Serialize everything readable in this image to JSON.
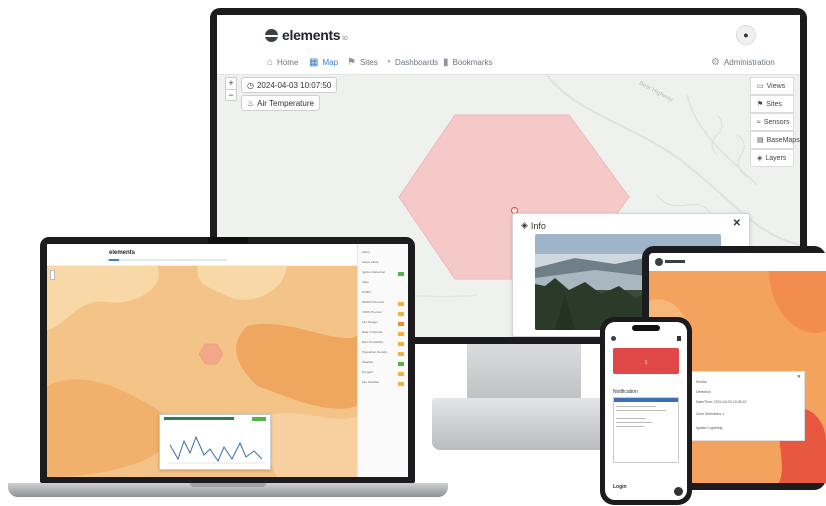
{
  "monitor": {
    "brand": {
      "name": "elements",
      "suffix": "io"
    },
    "user_icon": "user-icon",
    "nav": {
      "items": [
        {
          "label": "Home",
          "icon": "home-icon",
          "glyph": "⌂"
        },
        {
          "label": "Map",
          "icon": "map-icon",
          "glyph": "▦",
          "active": true
        },
        {
          "label": "Sites",
          "icon": "flag-icon",
          "glyph": "⚑"
        },
        {
          "label": "Dashboards",
          "icon": "dashboard-icon",
          "glyph": "◔"
        },
        {
          "label": "Bookmarks",
          "icon": "bookmark-icon",
          "glyph": "▮"
        }
      ],
      "admin": {
        "label": "Administration",
        "icon": "gear-icon",
        "glyph": "⚙"
      }
    },
    "map": {
      "zoom_in": "+",
      "zoom_out": "−",
      "timestamp": "2024-04-03 10:07:50",
      "layer_chip": "Air Temperature",
      "road_label": "Bear Highway",
      "side_buttons": [
        {
          "label": "Views",
          "glyph": "▭"
        },
        {
          "label": "Sites",
          "glyph": "⚑"
        },
        {
          "label": "Sensors",
          "glyph": "≈"
        },
        {
          "label": "BaseMaps",
          "glyph": "▤"
        },
        {
          "label": "Layers",
          "glyph": "◈"
        }
      ],
      "info_popup": {
        "title": "Info",
        "close": "✕"
      },
      "colors": {
        "hexagon": "#f6c9c9",
        "hexagon_stroke": "#f0b8b8"
      }
    }
  },
  "laptop": {
    "brand": "elements",
    "sidebar_rows": [
      {
        "label": "Alerts",
        "tag": ""
      },
      {
        "label": "Active Alerts",
        "tag": ""
      },
      {
        "label": "Ignition Detection",
        "tag": "g"
      },
      {
        "label": "Sites",
        "tag": ""
      },
      {
        "label": "GOES",
        "tag": ""
      },
      {
        "label": "MODIS Thermal",
        "tag": "y"
      },
      {
        "label": "VIIRS Thermal",
        "tag": "y"
      },
      {
        "label": "Fire Danger",
        "tag": "o"
      },
      {
        "label": "Rate of Spread",
        "tag": "y"
      },
      {
        "label": "Burn Probability",
        "tag": "y"
      },
      {
        "label": "Population Density",
        "tag": "y"
      },
      {
        "label": "Weather",
        "tag": "g"
      },
      {
        "label": "Drought",
        "tag": "y"
      },
      {
        "label": "Fire Weather",
        "tag": "y"
      }
    ]
  },
  "tablet": {
    "modal_lines": [
      "Smoke",
      "Detection",
      "Date/Time: 2024-04-03 10:05:22",
      "Zone Selections 1",
      "Ignition Lightning"
    ]
  },
  "phone": {
    "notification_title": "Notification",
    "alert_count": "1",
    "login_label": "Login"
  }
}
